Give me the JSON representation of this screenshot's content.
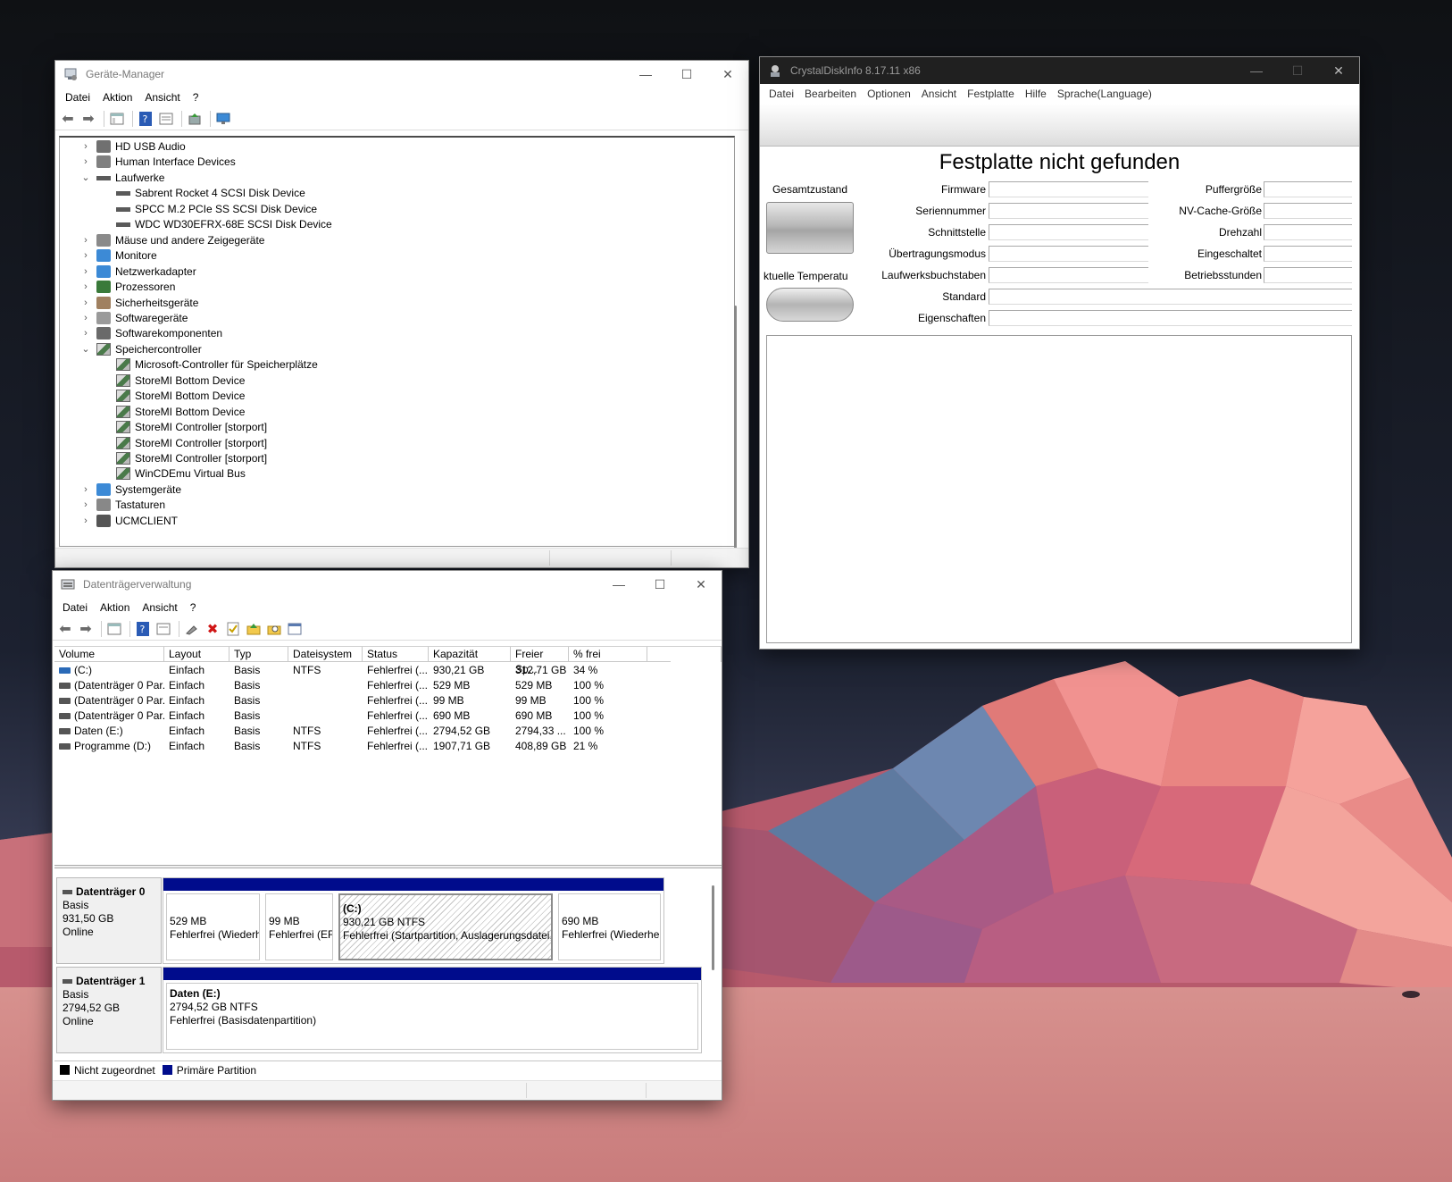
{
  "device_manager": {
    "title": "Geräte-Manager",
    "menu": [
      "Datei",
      "Aktion",
      "Ansicht",
      "?"
    ],
    "tree": [
      {
        "label": "HD USB Audio",
        "expander": "›",
        "level": 0,
        "icon": "audio-icon"
      },
      {
        "label": "Human Interface Devices",
        "expander": "›",
        "level": 0,
        "icon": "hid-icon"
      },
      {
        "label": "Laufwerke",
        "expander": "⌄",
        "level": 0,
        "icon": "drive-icon"
      },
      {
        "label": "Sabrent Rocket 4 SCSI Disk Device",
        "expander": "",
        "level": 1,
        "icon": "drive-icon"
      },
      {
        "label": "SPCC M.2 PCIe SS SCSI Disk Device",
        "expander": "",
        "level": 1,
        "icon": "drive-icon"
      },
      {
        "label": "WDC WD30EFRX-68E SCSI Disk Device",
        "expander": "",
        "level": 1,
        "icon": "drive-icon"
      },
      {
        "label": "Mäuse und andere Zeigegeräte",
        "expander": "›",
        "level": 0,
        "icon": "mouse-icon"
      },
      {
        "label": "Monitore",
        "expander": "›",
        "level": 0,
        "icon": "monitor-icon"
      },
      {
        "label": "Netzwerkadapter",
        "expander": "›",
        "level": 0,
        "icon": "network-icon"
      },
      {
        "label": "Prozessoren",
        "expander": "›",
        "level": 0,
        "icon": "processor-icon"
      },
      {
        "label": "Sicherheitsgeräte",
        "expander": "›",
        "level": 0,
        "icon": "security-icon"
      },
      {
        "label": "Softwaregeräte",
        "expander": "›",
        "level": 0,
        "icon": "software-device-icon"
      },
      {
        "label": "Softwarekomponenten",
        "expander": "›",
        "level": 0,
        "icon": "software-component-icon"
      },
      {
        "label": "Speichercontroller",
        "expander": "⌄",
        "level": 0,
        "icon": "storage-controller-icon"
      },
      {
        "label": "Microsoft-Controller für Speicherplätze",
        "expander": "",
        "level": 1,
        "icon": "storage-controller-icon"
      },
      {
        "label": "StoreMI Bottom Device",
        "expander": "",
        "level": 1,
        "icon": "storage-controller-icon"
      },
      {
        "label": "StoreMI Bottom Device",
        "expander": "",
        "level": 1,
        "icon": "storage-controller-icon"
      },
      {
        "label": "StoreMI Bottom Device",
        "expander": "",
        "level": 1,
        "icon": "storage-controller-icon"
      },
      {
        "label": "StoreMI Controller [storport]",
        "expander": "",
        "level": 1,
        "icon": "storage-controller-icon"
      },
      {
        "label": "StoreMI Controller [storport]",
        "expander": "",
        "level": 1,
        "icon": "storage-controller-icon"
      },
      {
        "label": "StoreMI Controller [storport]",
        "expander": "",
        "level": 1,
        "icon": "storage-controller-icon"
      },
      {
        "label": "WinCDEmu Virtual Bus",
        "expander": "",
        "level": 1,
        "icon": "storage-controller-icon"
      },
      {
        "label": "Systemgeräte",
        "expander": "›",
        "level": 0,
        "icon": "system-device-icon"
      },
      {
        "label": "Tastaturen",
        "expander": "›",
        "level": 0,
        "icon": "keyboard-icon"
      },
      {
        "label": "UCMCLIENT",
        "expander": "›",
        "level": 0,
        "icon": "usb-icon"
      }
    ]
  },
  "disk_management": {
    "title": "Datenträgerverwaltung",
    "menu": [
      "Datei",
      "Aktion",
      "Ansicht",
      "?"
    ],
    "columns": [
      "Volume",
      "Layout",
      "Typ",
      "Dateisystem",
      "Status",
      "Kapazität",
      "Freier Sp...",
      "% frei"
    ],
    "rows": [
      [
        "(C:)",
        "Einfach",
        "Basis",
        "NTFS",
        "Fehlerfrei (...",
        "930,21 GB",
        "312,71 GB",
        "34 %"
      ],
      [
        "(Datenträger 0 Par...",
        "Einfach",
        "Basis",
        "",
        "Fehlerfrei (...",
        "529 MB",
        "529 MB",
        "100 %"
      ],
      [
        "(Datenträger 0 Par...",
        "Einfach",
        "Basis",
        "",
        "Fehlerfrei (...",
        "99 MB",
        "99 MB",
        "100 %"
      ],
      [
        "(Datenträger 0 Par...",
        "Einfach",
        "Basis",
        "",
        "Fehlerfrei (...",
        "690 MB",
        "690 MB",
        "100 %"
      ],
      [
        "Daten (E:)",
        "Einfach",
        "Basis",
        "NTFS",
        "Fehlerfrei (...",
        "2794,52 GB",
        "2794,33 ...",
        "100 %"
      ],
      [
        "Programme (D:)",
        "Einfach",
        "Basis",
        "NTFS",
        "Fehlerfrei (...",
        "1907,71 GB",
        "408,89 GB",
        "21 %"
      ]
    ],
    "disks": [
      {
        "name": "Datenträger 0",
        "type": "Basis",
        "size": "931,50 GB",
        "state": "Online",
        "partitions": [
          {
            "title": "",
            "line1": "529 MB",
            "line2": "Fehlerfrei (Wiederh",
            "hatched": false
          },
          {
            "title": "",
            "line1": "99 MB",
            "line2": "Fehlerfrei (EF",
            "hatched": false
          },
          {
            "title": "(C:)",
            "line1": "930,21 GB NTFS",
            "line2": "Fehlerfrei (Startpartition, Auslagerungsdatei,",
            "hatched": true
          },
          {
            "title": "",
            "line1": "690 MB",
            "line2": "Fehlerfrei (Wiederhe",
            "hatched": false
          }
        ]
      },
      {
        "name": "Datenträger 1",
        "type": "Basis",
        "size": "2794,52 GB",
        "state": "Online",
        "partitions": [
          {
            "title": "Daten  (E:)",
            "line1": "2794,52 GB NTFS",
            "line2": "Fehlerfrei (Basisdatenpartition)",
            "hatched": false
          }
        ]
      }
    ],
    "legend": [
      {
        "label": "Nicht zugeordnet",
        "color": "#000000"
      },
      {
        "label": "Primäre Partition",
        "color": "#000c8c"
      }
    ]
  },
  "crystaldiskinfo": {
    "title": "CrystalDiskInfo 8.17.11 x86",
    "menu": [
      "Datei",
      "Bearbeiten",
      "Optionen",
      "Ansicht",
      "Festplatte",
      "Hilfe",
      "Sprache(Language)"
    ],
    "heading": "Festplatte nicht gefunden",
    "health_label": "Gesamtzustand",
    "temp_label": "ktuelle Temperatu",
    "fields_left": [
      "Firmware",
      "Seriennummer",
      "Schnittstelle",
      "Übertragungsmodus",
      "Laufwerksbuchstaben"
    ],
    "fields_right": [
      "Puffergröße",
      "NV-Cache-Größe",
      "Drehzahl",
      "Eingeschaltet",
      "Betriebsstunden"
    ],
    "fields_wide": [
      "Standard",
      "Eigenschaften"
    ]
  },
  "colors": {
    "partition_bar": "#000c8c",
    "wallpaper_dark": "#121417",
    "wallpaper_ground": "#cf8a8a"
  }
}
